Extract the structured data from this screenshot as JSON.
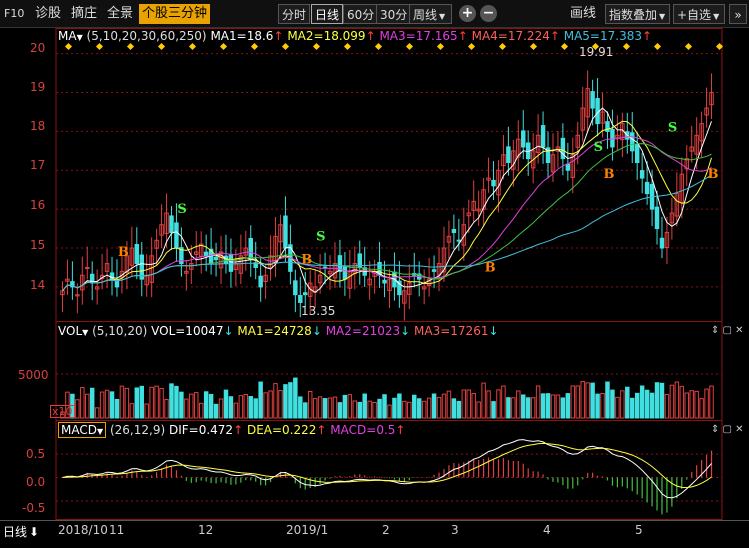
{
  "toolbar": {
    "left_items": [
      "F10",
      "诊股",
      "摘庄",
      "全景"
    ],
    "active_tab": "个股三分钟",
    "period_buttons": [
      "分时",
      "日线",
      "60分",
      "30分"
    ],
    "active_period": "日线",
    "week_select": "周线",
    "plus_label": "+",
    "minus_label": "−",
    "draw_label": "画线",
    "overlay_label": "指数叠加",
    "custom_label": "+自选"
  },
  "price_panel": {
    "legend": {
      "name": "MA",
      "params": "(5,10,20,30,60,250)",
      "ma1": "MA1=18.6",
      "ma2": "MA2=18.099",
      "ma3": "MA3=17.165",
      "ma4": "MA4=17.224",
      "ma5": "MA5=17.383"
    },
    "y_ticks": [
      "20",
      "19",
      "18",
      "17",
      "16",
      "15",
      "14"
    ],
    "high_annotation": "19.91",
    "low_annotation": "13.35"
  },
  "volume_panel": {
    "legend": {
      "name": "VOL",
      "params": "(5,10,20)",
      "vol": "VOL=10047",
      "ma1": "MA1=24728",
      "ma2": "MA2=21023",
      "ma3": "MA3=17261"
    },
    "y_ticks": [
      "5000"
    ],
    "unit": "x10"
  },
  "macd_panel": {
    "legend": {
      "name": "MACD",
      "params": "(26,12,9)",
      "dif": "DIF=0.472",
      "dea": "DEA=0.222",
      "macd": "MACD=0.5"
    },
    "y_ticks": [
      "0.5",
      "0.0",
      "-0.5"
    ]
  },
  "date_axis": {
    "period_label": "日线",
    "labels": [
      "2018/10",
      "11",
      "12",
      "2019/1",
      "2",
      "3",
      "4",
      "5"
    ]
  },
  "colors": {
    "up": "#e04040",
    "down": "#40e0e0",
    "ma1": "#ffffff",
    "ma2": "#ffff40",
    "ma3": "#e040e0",
    "ma4": "#40c040",
    "ma5": "#40c0e0",
    "grid": "#8b1010",
    "buy": "#ff8000",
    "sell": "#40ff40"
  },
  "chart_data": {
    "type": "candlestick",
    "closes": [
      13.9,
      14.2,
      14.0,
      13.8,
      14.3,
      14.5,
      14.1,
      14.0,
      14.3,
      14.6,
      14.2,
      14.0,
      14.4,
      14.8,
      15.0,
      14.6,
      14.2,
      14.3,
      14.8,
      15.2,
      15.6,
      15.9,
      15.4,
      15.0,
      14.6,
      14.4,
      14.6,
      14.9,
      15.1,
      14.8,
      14.6,
      14.7,
      14.9,
      14.6,
      14.4,
      14.6,
      14.8,
      15.0,
      14.7,
      14.5,
      14.0,
      14.3,
      14.8,
      15.3,
      15.6,
      15.0,
      14.4,
      13.8,
      13.6,
      13.8,
      14.1,
      14.0,
      14.3,
      14.5,
      14.4,
      14.6,
      14.4,
      14.2,
      14.4,
      14.6,
      14.5,
      14.3,
      14.2,
      14.4,
      14.3,
      14.1,
      14.2,
      14.0,
      13.8,
      13.9,
      14.1,
      14.3,
      14.2,
      14.0,
      14.2,
      14.4,
      14.6,
      15.0,
      15.3,
      15.4,
      15.2,
      15.6,
      15.9,
      16.2,
      16.0,
      16.5,
      16.8,
      16.6,
      17.0,
      17.4,
      17.2,
      17.5,
      17.8,
      17.6,
      17.3,
      17.5,
      17.9,
      17.6,
      17.2,
      17.4,
      17.6,
      17.3,
      17.0,
      17.4,
      17.9,
      18.6,
      19.1,
      18.6,
      18.2,
      18.5,
      18.0,
      17.6,
      17.9,
      18.2,
      17.8,
      17.5,
      17.2,
      16.8,
      16.4,
      16.0,
      15.5,
      15.0,
      15.4,
      15.9,
      16.4,
      16.9,
      17.3,
      17.6,
      17.9,
      18.2,
      18.6,
      19.0
    ],
    "volume_ticks": [
      "5000"
    ],
    "macd_range": [
      -0.8,
      0.8
    ],
    "price_range": [
      13.2,
      20.3
    ]
  }
}
